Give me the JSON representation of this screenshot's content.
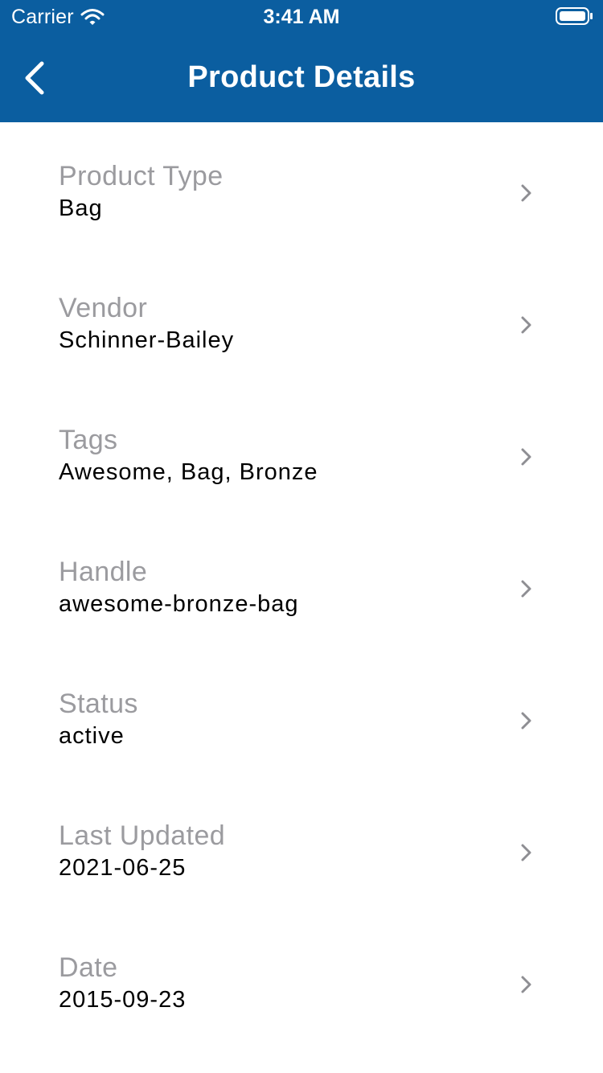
{
  "status_bar": {
    "carrier": "Carrier",
    "time": "3:41 AM",
    "icons": [
      "wifi-icon",
      "battery-icon"
    ]
  },
  "nav": {
    "title": "Product Details",
    "back_icon": "chevron-left-icon"
  },
  "colors": {
    "header_background": "#0b5ea0",
    "label_text": "#9b9b9f",
    "value_text": "#000000",
    "chevron": "#8e8e93"
  },
  "details": [
    {
      "label": "Product Type",
      "value": "Bag"
    },
    {
      "label": "Vendor",
      "value": "Schinner-Bailey"
    },
    {
      "label": "Tags",
      "value": "Awesome, Bag, Bronze"
    },
    {
      "label": "Handle",
      "value": "awesome-bronze-bag"
    },
    {
      "label": "Status",
      "value": "active"
    },
    {
      "label": "Last Updated",
      "value": "2021-06-25"
    },
    {
      "label": "Date",
      "value": "2015-09-23"
    }
  ]
}
